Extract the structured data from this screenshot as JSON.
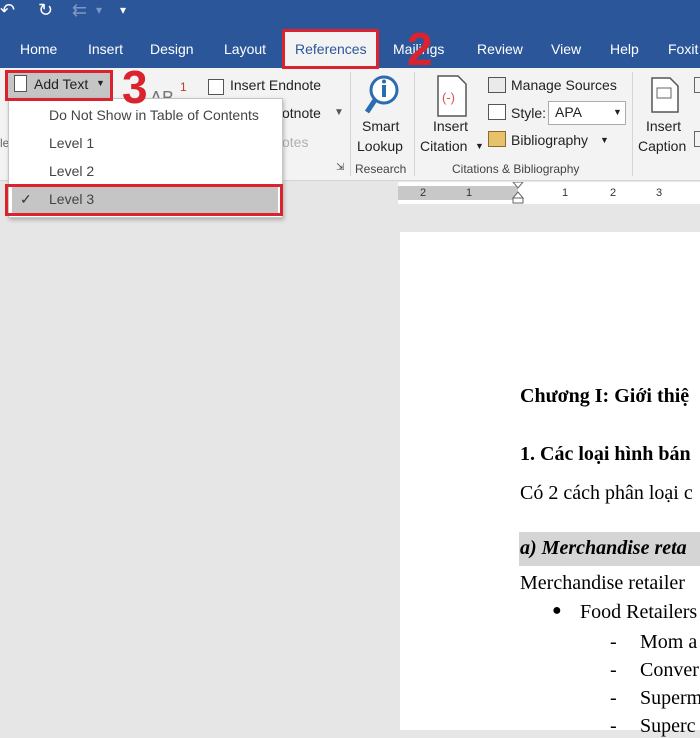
{
  "ribbon_tabs": [
    "Home",
    "Insert",
    "Design",
    "Layout",
    "References",
    "Mailings",
    "Review",
    "View",
    "Help",
    "Foxit"
  ],
  "table_of_contents": {
    "add_text_label": "Add Text",
    "menu_items": [
      "Do Not Show in Table of Contents",
      "Level 1",
      "Level 2",
      "Level 3"
    ],
    "checked_item": "Level 3"
  },
  "footnotes": {
    "superscript_label": "AB",
    "superscript_number": "1",
    "insert_endnote": "Insert Endnote",
    "next_footnote_partial": "otnote",
    "group_label_partial": "otes"
  },
  "research": {
    "smart_lookup_line1": "Smart",
    "smart_lookup_line2": "Lookup",
    "group_label": "Research"
  },
  "citations": {
    "insert_citation_line1": "Insert",
    "insert_citation_line2": "Citation",
    "manage_sources": "Manage Sources",
    "style_label": "Style:",
    "style_value": "APA",
    "bibliography": "Bibliography",
    "group_label": "Citations & Bibliography"
  },
  "captions": {
    "insert_caption_line1": "Insert",
    "insert_caption_line2": "Caption"
  },
  "steps": [
    "2",
    "3"
  ],
  "ruler_labels": [
    "2",
    "1",
    "1",
    "2",
    "3"
  ],
  "document": {
    "chapter_heading": "Chương I: Giới thiệ",
    "section_heading": "1. Các loại hình bán",
    "intro_text": "Có 2 cách phân loại c",
    "subheading": "a) Merchandise reta",
    "body_text": "Merchandise retailer",
    "bullet": "Food Retailers",
    "dash_items": [
      "Mom a",
      "Conver",
      "Superm",
      "Superc"
    ]
  },
  "colors": {
    "accent": "#2b579a",
    "highlight": "#d9232e"
  }
}
